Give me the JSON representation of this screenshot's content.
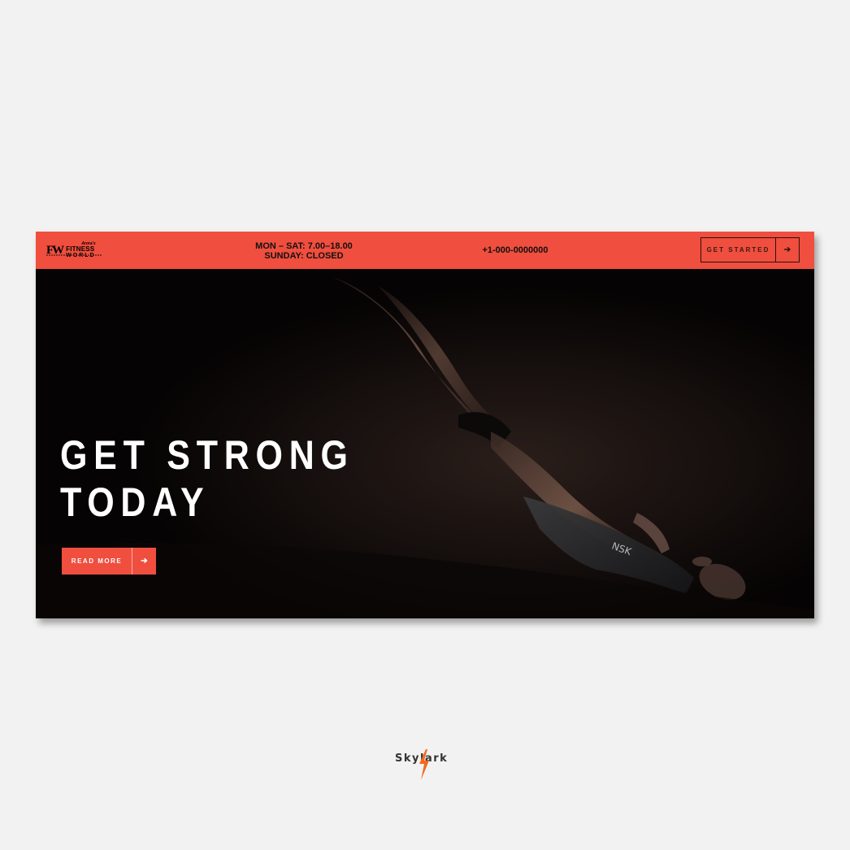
{
  "brand": {
    "owner": "Arora's",
    "mark": "FW",
    "line1": "FITNESS",
    "line2": "WORLD"
  },
  "topbar": {
    "hours_line1": "MON – SAT: 7.00–18.00",
    "hours_line2": "SUNDAY: CLOSED",
    "phone": "+1-000-0000000",
    "cta_label": "GET STARTED",
    "cta_arrow": "➔"
  },
  "hero": {
    "headline_line1": "GET STRONG",
    "headline_line2": "TODAY",
    "button_label": "READ MORE",
    "button_arrow": "➔",
    "photo_icon": "woman-lying-workout-photo"
  },
  "watermark": {
    "text": "Skylark",
    "icon": "lightning-bolt-icon"
  },
  "colors": {
    "accent": "#f04e3e",
    "hero_bg": "#050303",
    "page_bg": "#f2f2f2",
    "dark_text": "#111111"
  }
}
